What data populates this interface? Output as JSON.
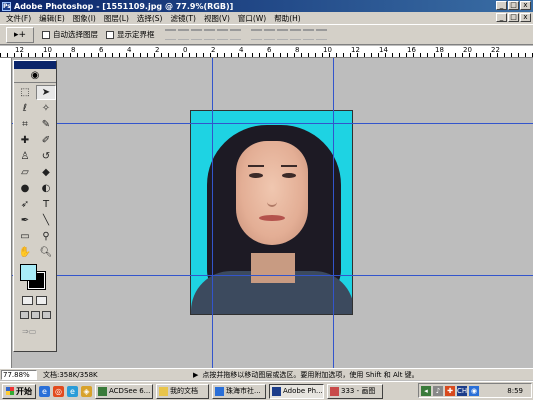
{
  "window": {
    "title": "Adobe Photoshop - [1551109.jpg @ 77.9%(RGB)]",
    "controls": [
      "_",
      "□",
      "x"
    ]
  },
  "menu": {
    "items": [
      "文件(F)",
      "编辑(E)",
      "图象(I)",
      "图层(L)",
      "选择(S)",
      "滤镜(T)",
      "视图(V)",
      "窗口(W)",
      "帮助(H)"
    ]
  },
  "options": {
    "tool_preset": "▸+",
    "auto_select_layer": "自动选择图层",
    "show_bounding_box": "显示定界框"
  },
  "ruler": {
    "top_labels": [
      "12",
      "10",
      "8",
      "6",
      "4",
      "2",
      "0",
      "2",
      "4",
      "6",
      "8",
      "10",
      "12",
      "14",
      "16",
      "18",
      "20",
      "22"
    ]
  },
  "toolbox": {
    "foreground_color": "#a8ecf8",
    "background_color": "#000000"
  },
  "document": {
    "background_color": "#1ed3e3"
  },
  "status": {
    "zoom": "77.88%",
    "doc_size": "文档:358K/358K",
    "hint": "点按并拖移以移动图层或选区。要用附加选项，使用 Shift 和 Alt 键。"
  },
  "taskbar": {
    "start_label": "开始",
    "tasks": [
      {
        "label": "ACDSee 6...",
        "active": false
      },
      {
        "label": "我的文档",
        "active": false
      },
      {
        "label": "珠海市社...",
        "active": false
      },
      {
        "label": "Adobe Ph...",
        "active": true
      },
      {
        "label": "333 - 画图",
        "active": false
      }
    ],
    "clock": "8:59"
  }
}
